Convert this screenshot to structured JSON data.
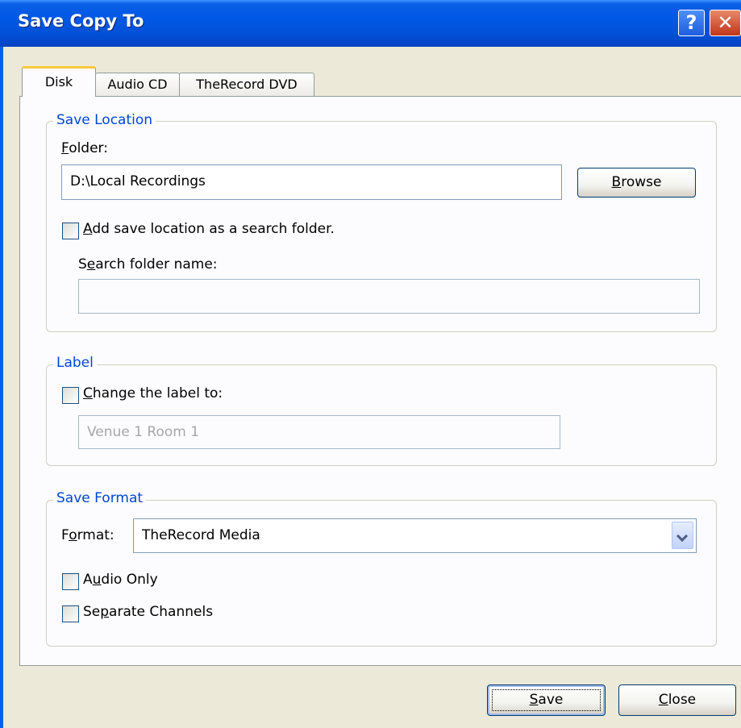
{
  "window": {
    "title": "Save Copy To",
    "help_glyph": "?",
    "close_glyph": "✕"
  },
  "tabs": [
    {
      "label": "Disk",
      "active": true
    },
    {
      "label": "Audio CD",
      "active": false
    },
    {
      "label": "TheRecord DVD",
      "active": false
    }
  ],
  "save_location": {
    "legend": "Save Location",
    "folder_label": {
      "pre": "",
      "key": "F",
      "post": "older:"
    },
    "folder_value": "D:\\Local Recordings",
    "browse": {
      "pre": "",
      "key": "B",
      "post": "rowse"
    },
    "add_search": {
      "pre": "",
      "key": "A",
      "post": "dd save location as a search folder.",
      "checked": false
    },
    "search_name_label": {
      "pre": "S",
      "key": "e",
      "post": "arch folder name:"
    },
    "search_name_value": ""
  },
  "label_group": {
    "legend": "Label",
    "change_label": {
      "pre": "",
      "key": "C",
      "post": "hange the label to:",
      "checked": false
    },
    "label_value": "Venue 1 Room 1"
  },
  "save_format": {
    "legend": "Save Format",
    "format_label": {
      "pre": "F",
      "key": "o",
      "post": "rmat:"
    },
    "format_value": "TheRecord Media",
    "audio_only": {
      "pre": "A",
      "key": "u",
      "post": "dio Only",
      "checked": false
    },
    "separate_channels": {
      "pre": "Se",
      "key": "p",
      "post": "arate Channels",
      "checked": false
    }
  },
  "footer": {
    "save": {
      "pre": "",
      "key": "S",
      "post": "ave"
    },
    "close": {
      "pre": "",
      "key": "C",
      "post": "lose"
    }
  }
}
